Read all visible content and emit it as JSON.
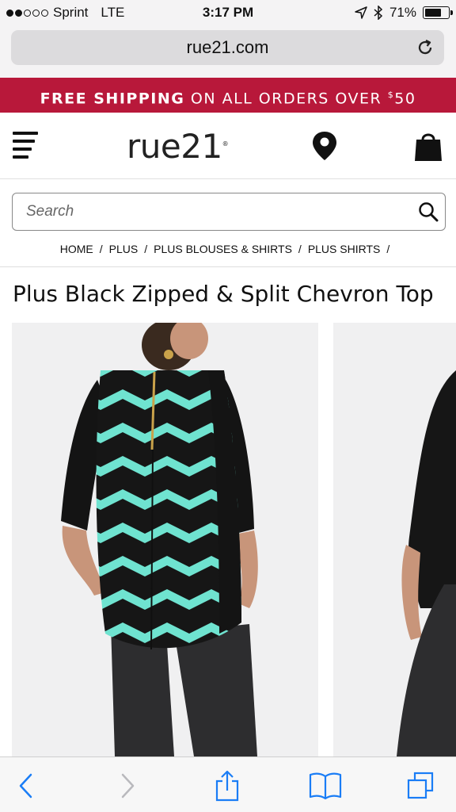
{
  "status_bar": {
    "carrier": "Sprint",
    "network": "LTE",
    "time": "3:17 PM",
    "battery": "71%",
    "battery_level": 0.71,
    "signal_bars_filled": 2,
    "signal_bars_total": 5
  },
  "browser": {
    "url": "rue21.com"
  },
  "promo": {
    "bold": "FREE SHIPPING",
    "text": " ON ALL ORDERS OVER ",
    "currency": "$",
    "amount": "50",
    "color": "#b8183a"
  },
  "site": {
    "logo": "rue21",
    "logo_mark": "®"
  },
  "search": {
    "placeholder": "Search"
  },
  "breadcrumb": {
    "items": [
      "HOME",
      "PLUS",
      "PLUS BLOUSES & SHIRTS",
      "PLUS SHIRTS"
    ],
    "separator": "/"
  },
  "product": {
    "title": "Plus Black Zipped & Split Chevron Top",
    "accent_color": "#6fe3d0"
  },
  "icons": {
    "reload": "reload-icon",
    "menu": "menu-icon",
    "store_locator": "map-pin-icon",
    "bag": "shopping-bag-icon",
    "search": "search-icon",
    "back": "back-icon",
    "forward": "forward-icon",
    "share": "share-icon",
    "bookmarks": "bookmarks-icon",
    "tabs": "tabs-icon"
  }
}
